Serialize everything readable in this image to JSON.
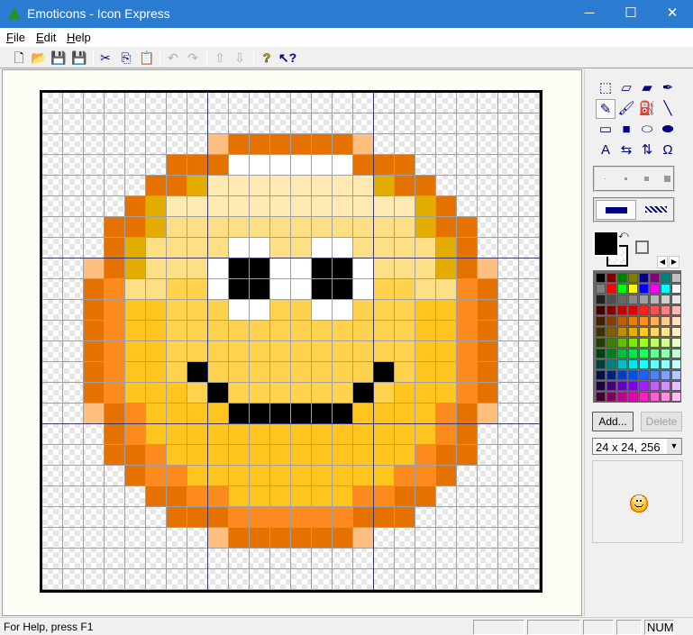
{
  "window": {
    "title": "Emoticons - Icon Express",
    "minimize": "─",
    "maximize": "☐",
    "close": "✕"
  },
  "menu": [
    {
      "key": "F",
      "rest": "ile"
    },
    {
      "key": "E",
      "rest": "dit"
    },
    {
      "key": "H",
      "rest": "elp"
    }
  ],
  "toolbar": {
    "new": "🗋",
    "open": "📂",
    "save": "💾",
    "save_all": "💾",
    "cut": "✂",
    "copy": "⎘",
    "paste": "📋",
    "undo": "↶",
    "redo": "↷",
    "up": "⇧",
    "down": "⇩",
    "help": "?",
    "context_help": "↖?"
  },
  "tools": [
    "⬚",
    "▱",
    "▰",
    "✒",
    "✎",
    "🖌",
    "⛽",
    "╲",
    "▭",
    "■",
    "⬭",
    "⬬",
    "A",
    "⇆",
    "⇅",
    "Ω"
  ],
  "palette": [
    "#000000",
    "#800000",
    "#008000",
    "#808000",
    "#000080",
    "#800080",
    "#008080",
    "#c0c0c0",
    "#808080",
    "#ff0000",
    "#00ff00",
    "#ffff00",
    "#0000ff",
    "#ff00ff",
    "#00ffff",
    "#ffffff",
    "#202020",
    "#505050",
    "#686868",
    "#888888",
    "#a0a0a0",
    "#b8b8b8",
    "#d0d0d0",
    "#e8e8e8",
    "#400000",
    "#800000",
    "#c00000",
    "#e00000",
    "#ff2020",
    "#ff5050",
    "#ff8080",
    "#ffb8b8",
    "#402000",
    "#804000",
    "#c06000",
    "#e88000",
    "#ff9020",
    "#ffb050",
    "#ffc890",
    "#ffe0c0",
    "#403000",
    "#806000",
    "#c09000",
    "#e8b000",
    "#ffc820",
    "#ffd860",
    "#ffe490",
    "#fff0c8",
    "#204000",
    "#408000",
    "#60c000",
    "#80e800",
    "#a0ff20",
    "#c0ff60",
    "#d0ff90",
    "#e8ffc8",
    "#004010",
    "#008020",
    "#00c040",
    "#00e850",
    "#20ff60",
    "#60ff90",
    "#90ffb0",
    "#c8ffd8",
    "#004040",
    "#008080",
    "#00c0c0",
    "#00e8e8",
    "#20ffff",
    "#60ffff",
    "#90ffff",
    "#c8ffff",
    "#001040",
    "#002080",
    "#0040c0",
    "#0050e8",
    "#2060ff",
    "#5080ff",
    "#80a0ff",
    "#b8c8ff",
    "#200040",
    "#400080",
    "#6000c0",
    "#8000e8",
    "#a020ff",
    "#c060ff",
    "#d090ff",
    "#e8c0ff",
    "#400030",
    "#800060",
    "#c00090",
    "#e800b0",
    "#ff20c0",
    "#ff60d0",
    "#ff90e0",
    "#ffc0f0"
  ],
  "colors": {
    "foreground": "#000000"
  },
  "buttons": {
    "add": "Add...",
    "delete": "Delete"
  },
  "format_select": "24 x 24, 256",
  "status": {
    "help": "For Help, press F1",
    "num": "NUM"
  },
  "icon": {
    "colors": {
      "D": "#e57200",
      "O": "#fd8a1e",
      "P": "#febe80",
      "G": "#e3ac00",
      "W": "#ffffff",
      "K": "#000000",
      "L": "#ffe9b3",
      "M": "#ffdf86",
      "Y": "#fed24e",
      "Z": "#ffc41e"
    },
    "rows": [
      "........................",
      "........................",
      "........PDDDDDDP........",
      "......DDDWWWWWWDDD......",
      ".....DDGLLLLLLLLGDD.....",
      "....DGLLLLLLLLLLLLGD....",
      "...DDGMMMMMMMMMMMMGDD...",
      "...DGMMMMWWMMWWMMMMGD...",
      "..PDGMMMWKKWWKKWMMMGDP..",
      "..DOMMYYWKKWWKKWYYMMOD..",
      "..DOZZYYYWWYYWWYYYZZOD..",
      "..DOZZYYYYYYYYYYYYZZOD..",
      "..DOZZYYYYYYYYYYYYZZOD..",
      "..DOZZYKYYYYYYYYKYZZOD..",
      "..DOZZZYKYYYYYYKYZZZOD..",
      "..PDOZZZZKKKKKKZZZZODP..",
      "...DOZZZZZZZZZZZZZZOD...",
      "...DDOZZZZZZZZZZZZODD...",
      "....DOOZZZZZZZZZZOOD....",
      ".....DDOOZZZZZZOODD.....",
      "......DDDOOOOOODDD......",
      "........PDDDDDDP........",
      "........................",
      "........................"
    ]
  }
}
